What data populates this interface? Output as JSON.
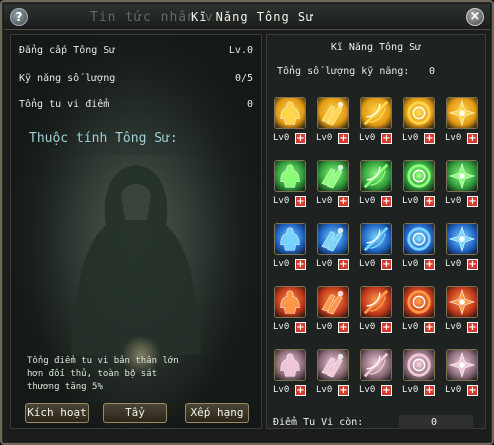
{
  "title_bg": "Tin tức nhân v",
  "title": "Kĩ Năng Tông Sư",
  "left": {
    "stats": [
      {
        "label": "Đẳng cấp Tông Sư",
        "value": "Lv.0"
      },
      {
        "label": "Kỹ năng số lượng",
        "value": "0/5"
      },
      {
        "label": "Tổng tu vi điểm",
        "value": "0"
      }
    ],
    "prop_header": "Thuộc tính Tông Sư:",
    "desc_lines": [
      "Tổng điểm tu vi bản thân lớn",
      "hơn đối thủ, toàn bộ sát",
      "thương tăng 5%"
    ],
    "buttons": [
      "Kích hoạt",
      "Tẩy",
      "Xếp hạng"
    ]
  },
  "right": {
    "title": "Kĩ Năng Tông Sư",
    "total_label": "Tổng số lượng kỹ năng:",
    "total_value": "0",
    "level_label": "Lv0",
    "remain_label": "Điểm Tu Vi còn:",
    "remain_value": "0"
  },
  "skill_rows": [
    {
      "color": "#e39a13",
      "glow": "#ffd64d",
      "icons": [
        "figure-icon",
        "claw-icon",
        "slash-icon",
        "swirl-icon",
        "burst-icon"
      ]
    },
    {
      "color": "#2f9b3b",
      "glow": "#8dff7a",
      "icons": [
        "figure-icon",
        "claw-icon",
        "slash-icon",
        "swirl-icon",
        "burst-icon"
      ]
    },
    {
      "color": "#1f63c4",
      "glow": "#7ad5ff",
      "icons": [
        "figure-icon",
        "claw-icon",
        "slash-icon",
        "swirl-icon",
        "burst-icon"
      ]
    },
    {
      "color": "#c0371a",
      "glow": "#ff9a4a",
      "icons": [
        "figure-icon",
        "claw-icon",
        "slash-icon",
        "swirl-icon",
        "burst-icon"
      ]
    },
    {
      "color": "#8a6b79",
      "glow": "#f0c8d8",
      "icons": [
        "figure-icon",
        "claw-icon",
        "slash-icon",
        "swirl-icon",
        "burst-icon"
      ]
    }
  ]
}
